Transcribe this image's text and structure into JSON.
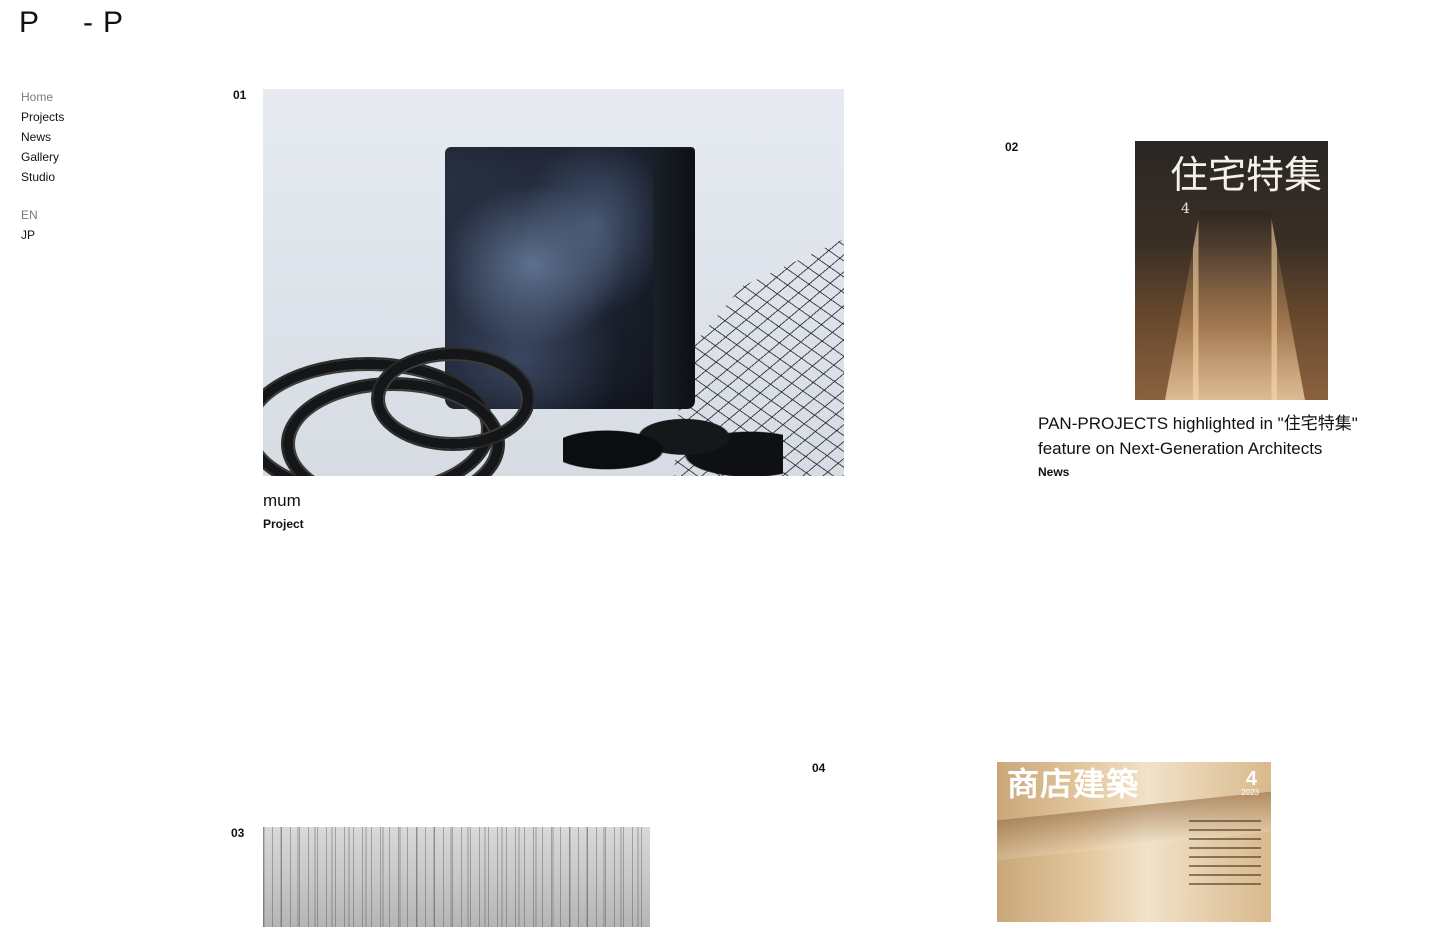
{
  "logo": {
    "left": "P",
    "dash": "-",
    "right": "P"
  },
  "nav": {
    "items": [
      {
        "label": "Home",
        "current": true
      },
      {
        "label": "Projects"
      },
      {
        "label": "News"
      },
      {
        "label": "Gallery"
      },
      {
        "label": "Studio"
      }
    ]
  },
  "lang": {
    "items": [
      {
        "label": "EN",
        "current": true
      },
      {
        "label": "JP"
      }
    ]
  },
  "items": [
    {
      "number": "01",
      "title": "mum",
      "category": "Project"
    },
    {
      "number": "02",
      "title_line1": "PAN-PROJECTS highlighted in \"住宅特集\"",
      "title_line2": "feature on Next-Generation Architects",
      "category": "News",
      "cover_title": "住宅特集",
      "cover_issue": "4"
    },
    {
      "number": "03"
    },
    {
      "number": "04",
      "cover_title": "商店建築",
      "cover_issue": "4",
      "cover_year": "2023"
    }
  ]
}
